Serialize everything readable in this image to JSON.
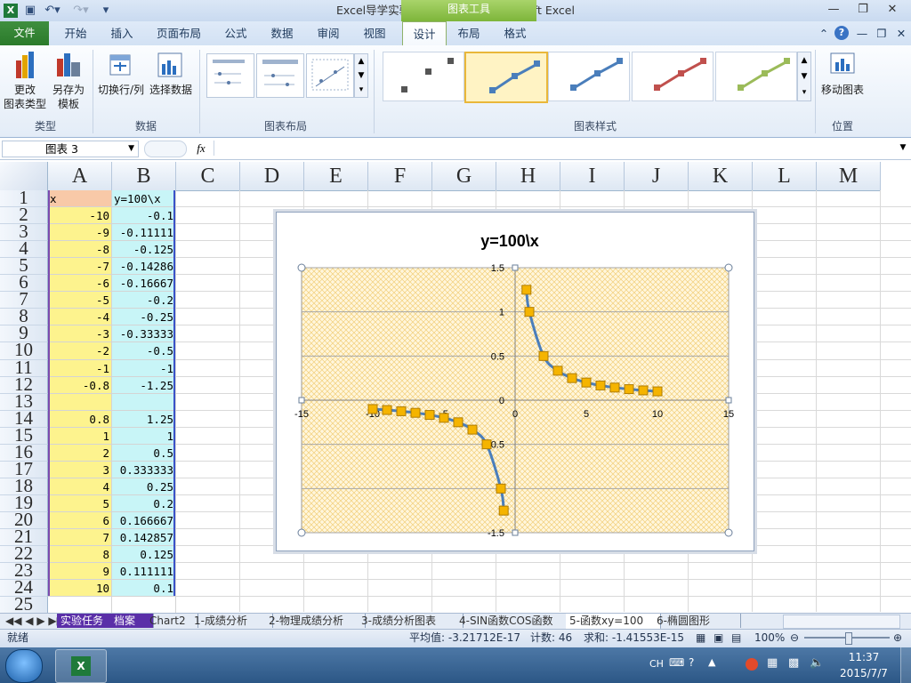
{
  "window": {
    "title": "Excel导学实验12-图表应用1  -  Microsoft Excel",
    "contextual_tab_group": "图表工具"
  },
  "ribbon": {
    "tabs": [
      "文件",
      "开始",
      "插入",
      "页面布局",
      "公式",
      "数据",
      "审阅",
      "视图",
      "设计",
      "布局",
      "格式"
    ],
    "active_tab": "设计",
    "groups": {
      "type": {
        "label": "类型",
        "buttons": [
          {
            "line1": "更改",
            "line2": "图表类型"
          },
          {
            "line1": "另存为",
            "line2": "模板"
          }
        ]
      },
      "data": {
        "label": "数据",
        "buttons": [
          {
            "line1": "切换行/列"
          },
          {
            "line1": "选择数据"
          }
        ]
      },
      "layout": {
        "label": "图表布局"
      },
      "styles": {
        "label": "图表样式",
        "colors": [
          "#555555",
          "#4a7ebb",
          "#4a7ebb",
          "#c0504d",
          "#9bbb59"
        ],
        "selected_index": 1
      },
      "location": {
        "label": "位置",
        "buttons": [
          {
            "line1": "移动图表"
          }
        ]
      }
    }
  },
  "formula_bar": {
    "name_box": "图表 3",
    "fx": "fx",
    "formula": ""
  },
  "sheet": {
    "columns": [
      "A",
      "B",
      "C",
      "D",
      "E",
      "F",
      "G",
      "H",
      "I",
      "J",
      "K",
      "L",
      "M"
    ],
    "rows": [
      {
        "n": "1",
        "a": "x",
        "b": "y=100\\x"
      },
      {
        "n": "2",
        "a": "-10",
        "b": "-0.1"
      },
      {
        "n": "3",
        "a": "-9",
        "b": "-0.11111"
      },
      {
        "n": "4",
        "a": "-8",
        "b": "-0.125"
      },
      {
        "n": "5",
        "a": "-7",
        "b": "-0.14286"
      },
      {
        "n": "6",
        "a": "-6",
        "b": "-0.16667"
      },
      {
        "n": "7",
        "a": "-5",
        "b": "-0.2"
      },
      {
        "n": "8",
        "a": "-4",
        "b": "-0.25"
      },
      {
        "n": "9",
        "a": "-3",
        "b": "-0.33333"
      },
      {
        "n": "10",
        "a": "-2",
        "b": "-0.5"
      },
      {
        "n": "11",
        "a": "-1",
        "b": "-1"
      },
      {
        "n": "12",
        "a": "-0.8",
        "b": "-1.25"
      },
      {
        "n": "13",
        "a": "",
        "b": ""
      },
      {
        "n": "14",
        "a": "0.8",
        "b": "1.25"
      },
      {
        "n": "15",
        "a": "1",
        "b": "1"
      },
      {
        "n": "16",
        "a": "2",
        "b": "0.5"
      },
      {
        "n": "17",
        "a": "3",
        "b": "0.333333"
      },
      {
        "n": "18",
        "a": "4",
        "b": "0.25"
      },
      {
        "n": "19",
        "a": "5",
        "b": "0.2"
      },
      {
        "n": "20",
        "a": "6",
        "b": "0.166667"
      },
      {
        "n": "21",
        "a": "7",
        "b": "0.142857"
      },
      {
        "n": "22",
        "a": "8",
        "b": "0.125"
      },
      {
        "n": "23",
        "a": "9",
        "b": "0.111111"
      },
      {
        "n": "24",
        "a": "10",
        "b": "0.1"
      },
      {
        "n": "25",
        "a": "",
        "b": ""
      }
    ]
  },
  "chart_data": {
    "type": "scatter",
    "title": "y=100\\x",
    "xlim": [
      -15,
      15
    ],
    "ylim": [
      -1.5,
      1.5
    ],
    "x_ticks": [
      "-15",
      "-10",
      "-5",
      "0",
      "5",
      "10",
      "15"
    ],
    "y_ticks": [
      "1.5",
      "1",
      "0.5",
      "0",
      "-0.5",
      "-1",
      "-1.5"
    ],
    "marker_color": "#f5b400",
    "line_color": "#4a7ebb",
    "plot_bg": "#fdf0c8",
    "series": [
      {
        "x": [
          -10,
          -9,
          -8,
          -7,
          -6,
          -5,
          -4,
          -3,
          -2,
          -1,
          -0.8
        ],
        "y": [
          -0.1,
          -0.11111,
          -0.125,
          -0.14286,
          -0.16667,
          -0.2,
          -0.25,
          -0.33333,
          -0.5,
          -1,
          -1.25
        ]
      },
      {
        "x": [
          0.8,
          1,
          2,
          3,
          4,
          5,
          6,
          7,
          8,
          9,
          10
        ],
        "y": [
          1.25,
          1,
          0.5,
          0.333333,
          0.25,
          0.2,
          0.166667,
          0.142857,
          0.125,
          0.111111,
          0.1
        ]
      }
    ]
  },
  "sheet_tabs": [
    "实验任务",
    "档案",
    "Chart2",
    "1-成绩分析",
    "2-物理成绩分析",
    "3-成绩分析图表",
    "4-SIN函数COS函数",
    "5-函数xy=100",
    "6-椭圆图形"
  ],
  "active_sheet_tab": "5-函数xy=100",
  "status": {
    "mode": "就绪",
    "average": "平均值: -3.21712E-17",
    "count": "计数: 46",
    "sum": "求和: -1.41553E-15",
    "zoom": "100%"
  },
  "taskbar": {
    "lang": "CH",
    "time": "11:37",
    "date": "2015/7/7"
  }
}
